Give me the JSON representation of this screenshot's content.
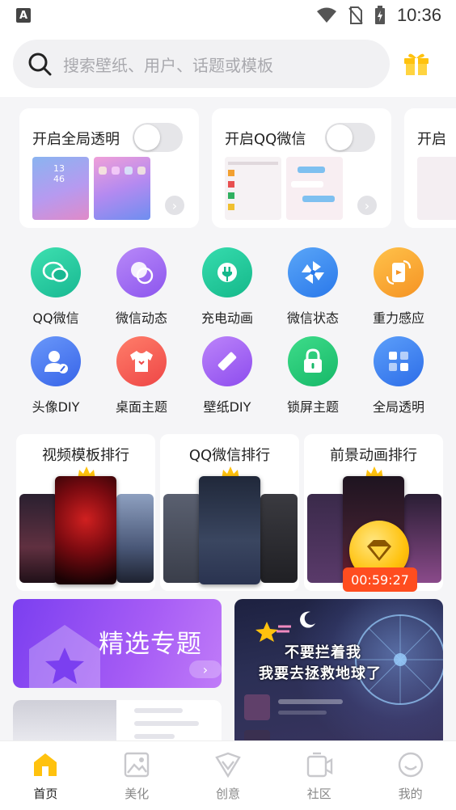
{
  "status_bar": {
    "time": "10:36",
    "app_letter": "A"
  },
  "search": {
    "placeholder": "搜索壁纸、用户、话题或模板"
  },
  "feature_cards": [
    {
      "title": "开启全局透明"
    },
    {
      "title": "开启QQ微信"
    },
    {
      "title": "开启"
    }
  ],
  "icon_grid": [
    {
      "label": "QQ微信",
      "icon": "chat-bubble-icon",
      "color": "#27c9a0"
    },
    {
      "label": "微信动态",
      "icon": "circles-icon",
      "color": "#a06ef2"
    },
    {
      "label": "充电动画",
      "icon": "plug-icon",
      "color": "#20c69a"
    },
    {
      "label": "微信状态",
      "icon": "pinwheel-icon",
      "color": "#3d8ff2"
    },
    {
      "label": "重力感应",
      "icon": "rotate-phone-icon",
      "color": "#f7a93a"
    },
    {
      "label": "头像DIY",
      "icon": "avatar-edit-icon",
      "color": "#4a78f0"
    },
    {
      "label": "桌面主题",
      "icon": "tshirt-icon",
      "color": "#f55f55"
    },
    {
      "label": "壁纸DIY",
      "icon": "ruler-pencil-icon",
      "color": "#a15cf0"
    },
    {
      "label": "锁屏主题",
      "icon": "lock-icon",
      "color": "#22c478"
    },
    {
      "label": "全局透明",
      "icon": "grid-squares-icon",
      "color": "#3a86f5"
    }
  ],
  "rankings": [
    {
      "title": "视频模板排行"
    },
    {
      "title": "QQ微信排行"
    },
    {
      "title": "前景动画排行",
      "countdown": "00:59:27"
    }
  ],
  "topic_card": {
    "title": "精选专题"
  },
  "promo_image": {
    "line1": "不要拦着我",
    "line2": "我要去拯救地球了"
  },
  "bottom_nav": [
    {
      "label": "首页",
      "icon": "home-icon",
      "active": true
    },
    {
      "label": "美化",
      "icon": "picture-icon",
      "active": false
    },
    {
      "label": "创意",
      "icon": "creative-icon",
      "active": false
    },
    {
      "label": "社区",
      "icon": "video-camera-icon",
      "active": false
    },
    {
      "label": "我的",
      "icon": "smile-icon",
      "active": false
    }
  ],
  "colors": {
    "accent": "#ffc20e",
    "purple": "#8a4cf2",
    "countdown": "#ff4d1f"
  }
}
